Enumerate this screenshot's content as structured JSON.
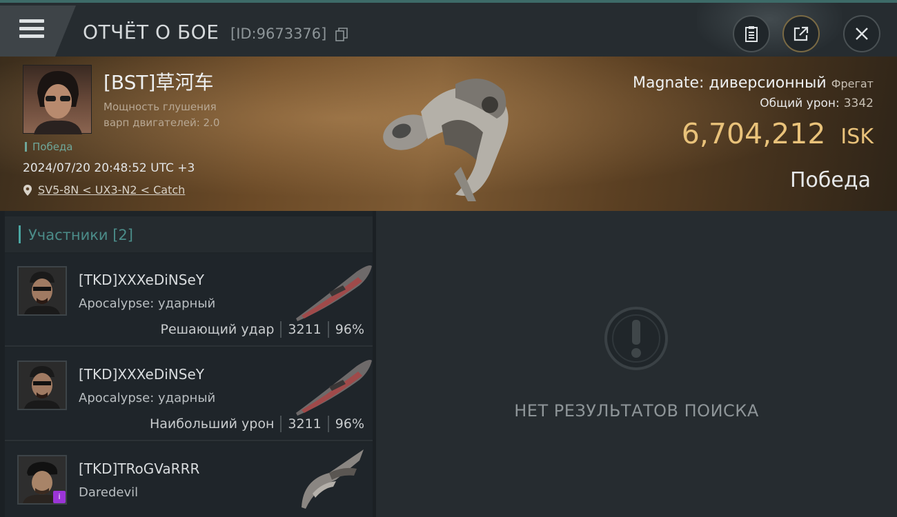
{
  "header": {
    "title": "ОТЧЁТ О БОЕ",
    "report_id": "[ID:9673376]"
  },
  "victim": {
    "pilot": "[BST]草河车",
    "stat_line_1": "Мощность глушения",
    "stat_line_2": "варп двигателей: 2.0",
    "outcome_small": "Победа",
    "timestamp": "2024/07/20 20:48:52 UTC +3",
    "location": "SV5-8N < UX3-N2 < Catch",
    "ship": "Magnate: диверсионный",
    "ship_class": "Фрегат",
    "damage_label": "Общий урон:",
    "damage_value": "3342",
    "isk_value": "6,704,212",
    "isk_unit": "ISK",
    "result": "Победа"
  },
  "participants": {
    "label": "Участники [2]",
    "rows": [
      {
        "name": "[TKD]XXXeDiNSeY",
        "ship": "Apocalypse: ударный",
        "role": "Решающий удар",
        "damage": "3211",
        "percent": "96%"
      },
      {
        "name": "[TKD]XXXeDiNSeY",
        "ship": "Apocalypse: ударный",
        "role": "Наибольший урон",
        "damage": "3211",
        "percent": "96%"
      },
      {
        "name": "[TKD]TRoGVaRRR",
        "ship": "Daredevil",
        "role": "",
        "damage": "",
        "percent": ""
      }
    ]
  },
  "empty_state": {
    "text": "НЕТ РЕЗУЛЬТАТОВ ПОИСКА"
  },
  "colors": {
    "accent": "#4ba7a3",
    "isk": "#e9c27a",
    "victory": "#6fa79a"
  },
  "icons": [
    "menu-icon",
    "copy-icon",
    "clipboard-icon",
    "share-icon",
    "close-icon",
    "location-pin-icon",
    "exclamation-icon"
  ]
}
